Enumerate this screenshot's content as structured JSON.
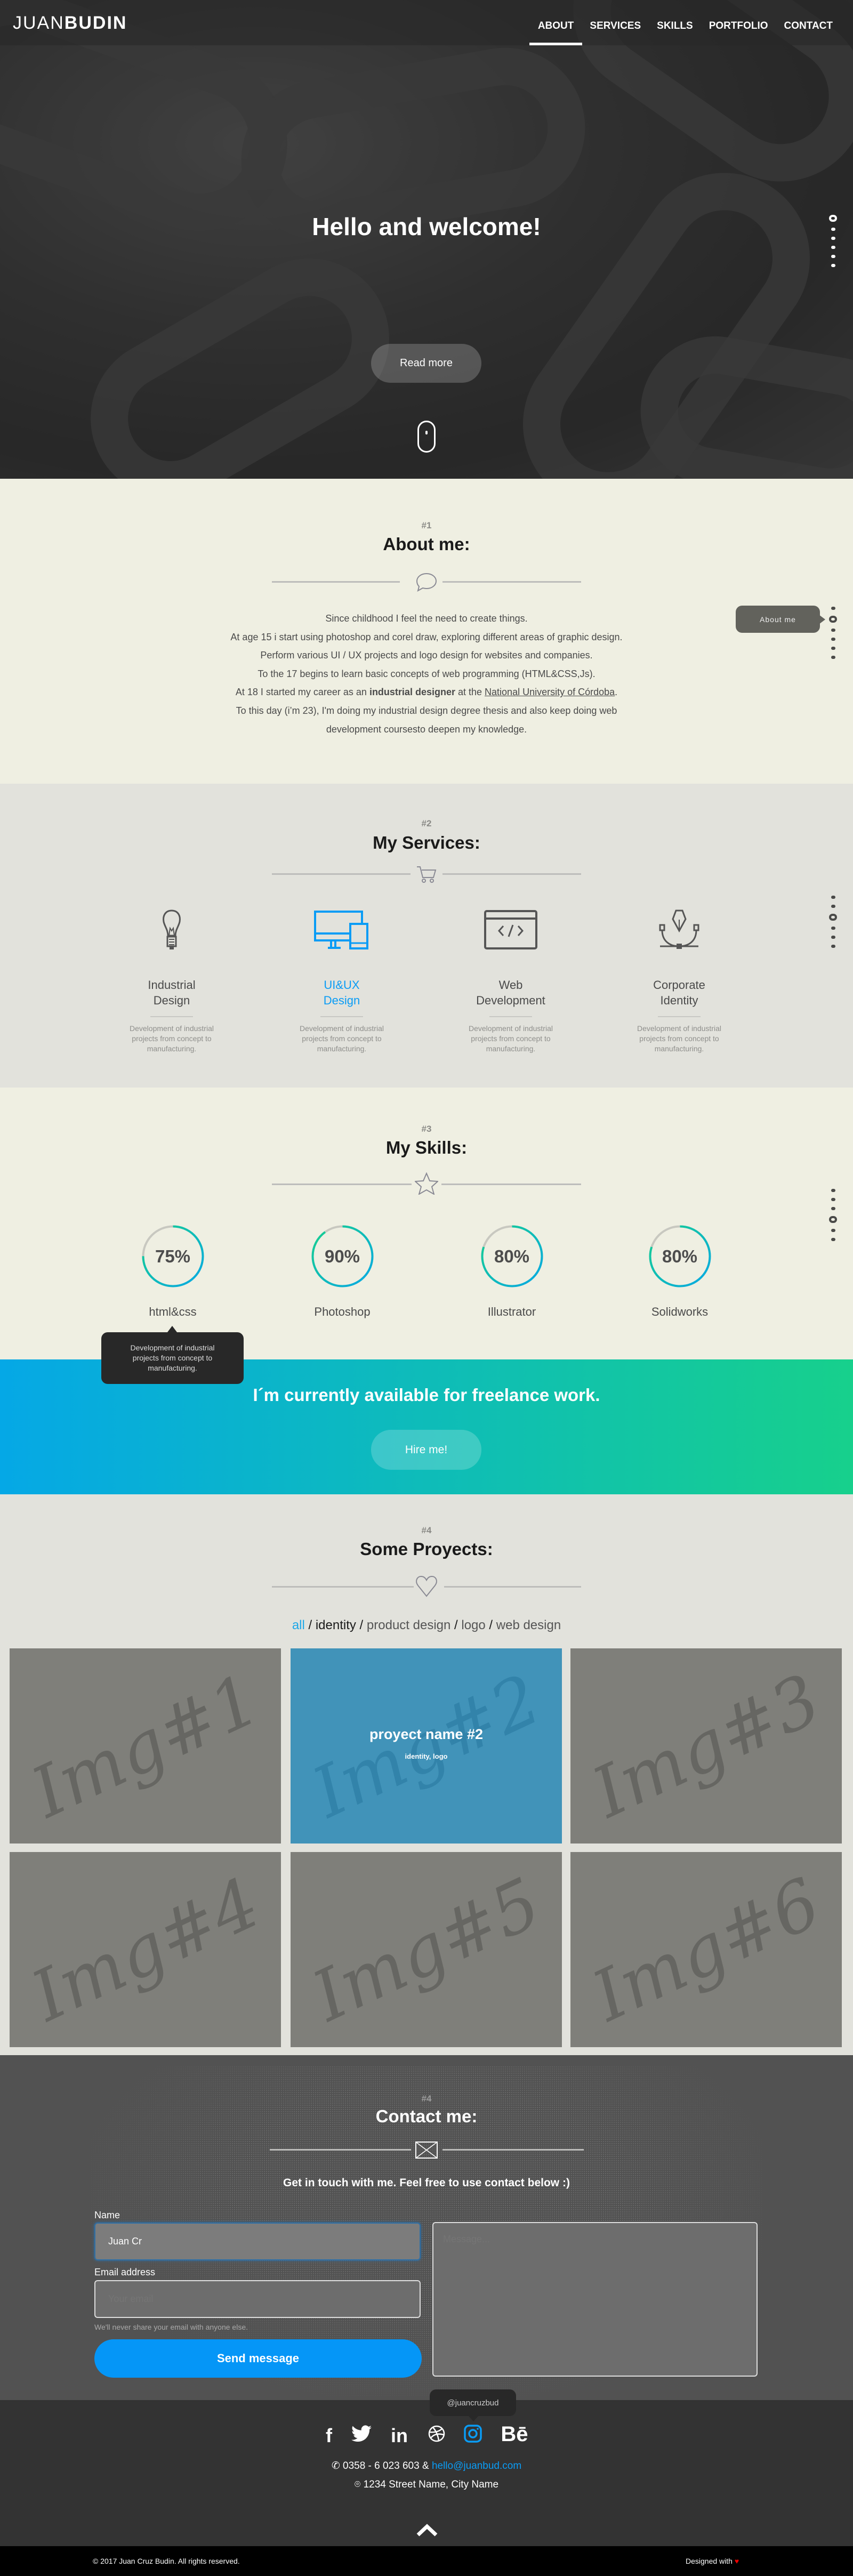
{
  "header": {
    "logo_light": "JUAN",
    "logo_bold": "BUDIN",
    "nav": [
      {
        "label": "ABOUT",
        "active": true
      },
      {
        "label": "SERVICES"
      },
      {
        "label": "SKILLS"
      },
      {
        "label": "PORTFOLIO"
      },
      {
        "label": "CONTACT"
      }
    ]
  },
  "hero": {
    "title": "Hello and welcome!",
    "button": "Read more",
    "scroll_icon": "mouse-icon"
  },
  "side_nav": {
    "tooltip": "About me"
  },
  "about": {
    "number": "#1",
    "title": "About me:",
    "icon": "speech-bubble-icon",
    "lines": [
      "Since childhood I feel the need to create things.",
      "At age 15 i start using photoshop and corel draw, exploring different areas of graphic design.",
      "Perform various UI / UX projects and logo design for websites and companies.",
      "To the 17 begins to learn basic concepts of web programming (HTML&CSS,Js)."
    ],
    "line5_a": "At 18 I started my career as an ",
    "line5_bold": "industrial designer",
    "line5_b": " at the ",
    "line5_link": "National University of Córdoba",
    "line5_c": ".",
    "line6": "To this day (i’m 23), I'm doing my industrial design degree thesis and also keep doing web",
    "line7": "development coursesto deepen my knowledge."
  },
  "services": {
    "number": "#2",
    "title": "My Services:",
    "icon": "cart-icon",
    "accent": "#0a9cf5",
    "items": [
      {
        "t1": "Industrial",
        "t2": "Design",
        "icon": "lightbulb-icon",
        "d1": "Development of industrial",
        "d2": "projects from concept to",
        "d3": "manufacturing."
      },
      {
        "t1": "UI&UX",
        "t2": "Design",
        "icon": "devices-icon",
        "active": true,
        "d1": "Development of industrial",
        "d2": "projects from concept to",
        "d3": "manufacturing."
      },
      {
        "t1": "Web",
        "t2": "Development",
        "icon": "code-window-icon",
        "d1": "Development of industrial",
        "d2": "projects from concept to",
        "d3": "manufacturing."
      },
      {
        "t1": "Corporate",
        "t2": "Identity",
        "icon": "pen-tool-icon",
        "d1": "Development of industrial",
        "d2": "projects from concept to",
        "d3": "manufacturing."
      }
    ]
  },
  "skills": {
    "number": "#3",
    "title": "My Skills:",
    "icon": "star-icon",
    "items": [
      {
        "label": "html&css",
        "value": 75,
        "text": "75%"
      },
      {
        "label": "Photoshop",
        "value": 90,
        "text": "90%"
      },
      {
        "label": "Illustrator",
        "value": 80,
        "text": "80%"
      },
      {
        "label": "Solidworks",
        "value": 80,
        "text": "80%"
      }
    ],
    "tooltip": [
      "Development of industrial",
      "projects from concept to",
      "manufacturing."
    ]
  },
  "freelance": {
    "title": "I´m  currently available for freelance work.",
    "button": "Hire me!",
    "gradient": [
      "#05a8e6",
      "#17d08c"
    ]
  },
  "projects": {
    "number": "#4",
    "title": "Some Proyects:",
    "icon": "heart-icon",
    "filters": [
      "all",
      "identity",
      "product design",
      "logo",
      "web design"
    ],
    "tiles": [
      "Img#1",
      "Img#2",
      "Img#3",
      "Img#4",
      "Img#5",
      "Img#6"
    ],
    "hover": {
      "name": "proyect name #2",
      "tags": "identity, logo"
    }
  },
  "contact": {
    "number": "#4",
    "title": "Contact me:",
    "icon": "envelope-icon",
    "subtitle": "Get in touch with me. Feel free to use contact below :)",
    "name_label": "Name",
    "name_value": "Juan Cr",
    "email_label": "Email address",
    "email_placeholder": "Your email",
    "email_help": "We'll never share your email with anyone else.",
    "message_placeholder": "Message...",
    "send": "Send message"
  },
  "footer": {
    "social": [
      "facebook-icon",
      "twitter-icon",
      "linkedin-icon",
      "dribbble-icon",
      "instagram-icon",
      "behance-icon"
    ],
    "instagram_tooltip": "@juancruzbud",
    "phone": "0358 - 6 023 603 & ",
    "email": "hello@juanbud.com",
    "address": "1234 Street Name, City Name",
    "copyright": "© 2017 Juan Cruz Budin. All rights reserved.",
    "designed": "Designed with"
  }
}
